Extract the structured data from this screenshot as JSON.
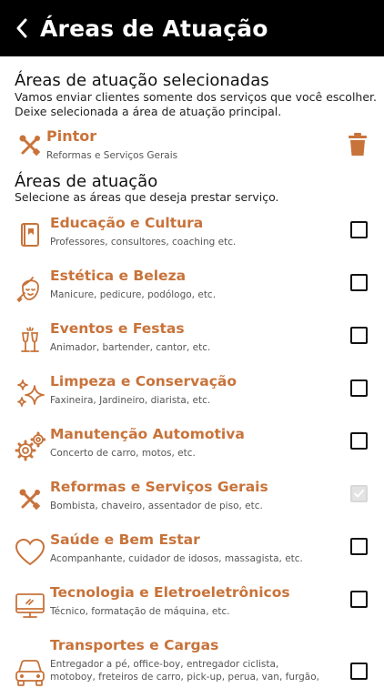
{
  "header": {
    "title": "Áreas de Atuação"
  },
  "selected_section": {
    "title": "Áreas de atuação selecionadas",
    "subtitle_line1": "Vamos enviar clientes somente dos serviços que você escolher.",
    "subtitle_line2": "Deixe selecionada a área de atuação principal.",
    "items": [
      {
        "name": "Pintor",
        "desc": "Reformas e Serviços Gerais",
        "icon": "tools-icon"
      }
    ]
  },
  "areas_section": {
    "title": "Áreas de atuação",
    "subtitle": "Selecione as áreas que deseja prestar serviço.",
    "items": [
      {
        "name": "Educação e Cultura",
        "desc": "Professores, consultores, coaching etc.",
        "icon": "book-icon",
        "checked": false
      },
      {
        "name": "Estética e Beleza",
        "desc": "Manicure, pedicure, podólogo, etc.",
        "icon": "beauty-face-icon",
        "checked": false
      },
      {
        "name": "Eventos e Festas",
        "desc": "Animador, bartender, cantor, etc.",
        "icon": "champagne-icon",
        "checked": false
      },
      {
        "name": "Limpeza e Conservação",
        "desc": "Faxineira, Jardineiro, diarista, etc.",
        "icon": "sparkle-icon",
        "checked": false
      },
      {
        "name": "Manutenção Automotiva",
        "desc": "Concerto de carro, motos, etc.",
        "icon": "gears-icon",
        "checked": false
      },
      {
        "name": "Reformas e Serviços Gerais",
        "desc": "Bombista, chaveiro, assentador de piso, etc.",
        "icon": "tools-icon",
        "checked": true
      },
      {
        "name": "Saúde e Bem Estar",
        "desc": "Acompanhante, cuidador de idosos, massagista, etc.",
        "icon": "heart-icon",
        "checked": false
      },
      {
        "name": "Tecnologia e Eletroeletrônicos",
        "desc": "Técnico, formatação de máquina, etc.",
        "icon": "monitor-icon",
        "checked": false
      },
      {
        "name": "Transportes e Cargas",
        "desc": "Entregador a pé, office-boy, entregador ciclista, motoboy, freteiros de carro, pick-up, perua, van, furgão,",
        "icon": "car-icon",
        "checked": false
      }
    ]
  },
  "colors": {
    "accent": "#c8733a",
    "header_bg": "#000000"
  }
}
